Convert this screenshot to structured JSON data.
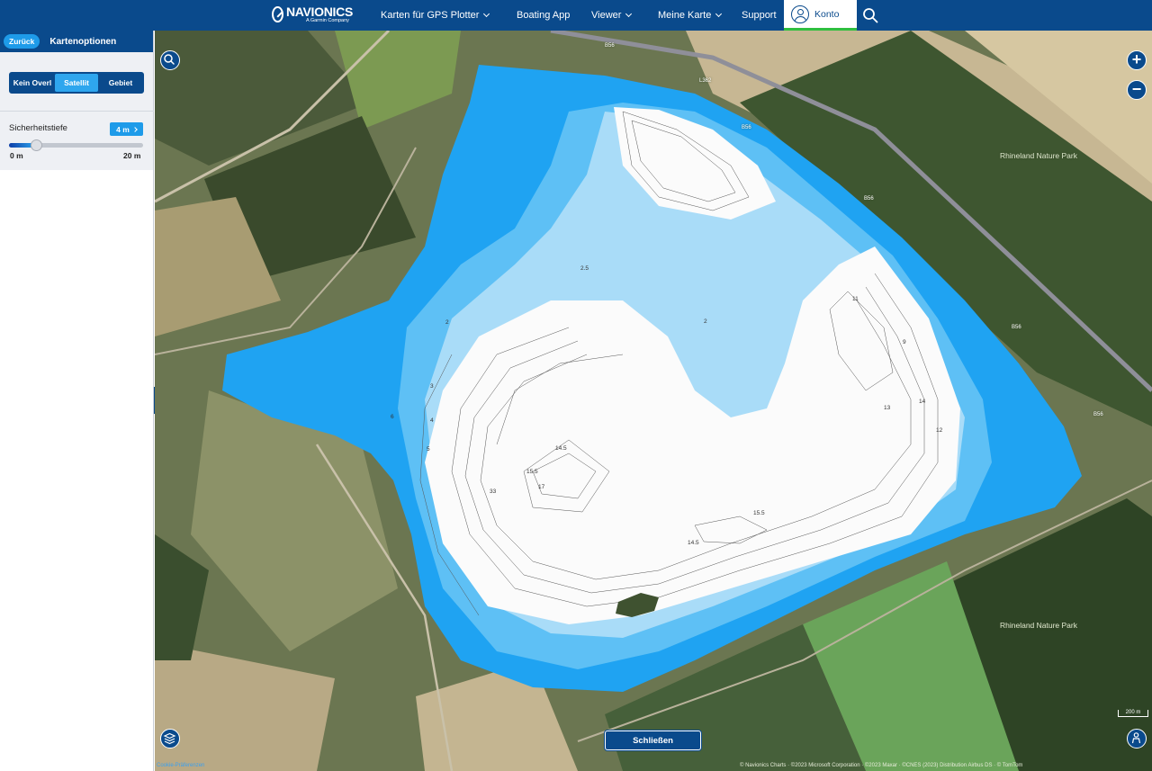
{
  "nav": {
    "logo_name": "NAVIONICS",
    "logo_sub": "A Garmin Company",
    "items": [
      {
        "label": "Karten für GPS Plotter",
        "has_dropdown": true
      },
      {
        "label": "Boating App",
        "has_dropdown": false
      },
      {
        "label": "Viewer",
        "has_dropdown": true
      },
      {
        "label": "Meine Karte",
        "has_dropdown": true
      },
      {
        "label": "Support",
        "has_dropdown": false
      }
    ],
    "account_label": "Konto",
    "search_icon": "search-icon"
  },
  "panel": {
    "back_label": "Zurück",
    "title": "Kartenoptionen",
    "overlay_options": [
      {
        "label": "Kein Overl",
        "active": false
      },
      {
        "label": "Satellit",
        "active": true
      },
      {
        "label": "Gebiet",
        "active": false
      }
    ],
    "safety_depth": {
      "label": "Sicherheitstiefe",
      "value": "4 m",
      "min_label": "0 m",
      "max_label": "20 m",
      "min": 0,
      "max": 20,
      "current": 4
    }
  },
  "map": {
    "place_labels": [
      "Rhineland Nature Park",
      "Rhineland Nature Park"
    ],
    "road_labels": [
      "B56",
      "L362",
      "B56",
      "B56",
      "B56",
      "B56"
    ],
    "depth_labels": [
      "2.5",
      "2",
      "3",
      "4",
      "6",
      "5",
      "2",
      "14.5",
      "15.5",
      "17",
      "15.5",
      "14.5",
      "13",
      "14",
      "12",
      "11",
      "9",
      "33"
    ],
    "close_label": "Schließen",
    "cookie_label": "Cookie-Präferenzen",
    "attribution": "© Navionics Charts · ©2023 Microsoft Corporation · ©2023 Maxar · ©CNES (2023) Distribution Airbus DS · © TomTom",
    "scale_label": "200 m",
    "colors": {
      "navy": "#0a4a8c",
      "accent": "#1e9be9",
      "shallow_water": "#1fa3f2",
      "deep_water": "#ffffff",
      "active_underline": "#2fbf3f"
    }
  }
}
